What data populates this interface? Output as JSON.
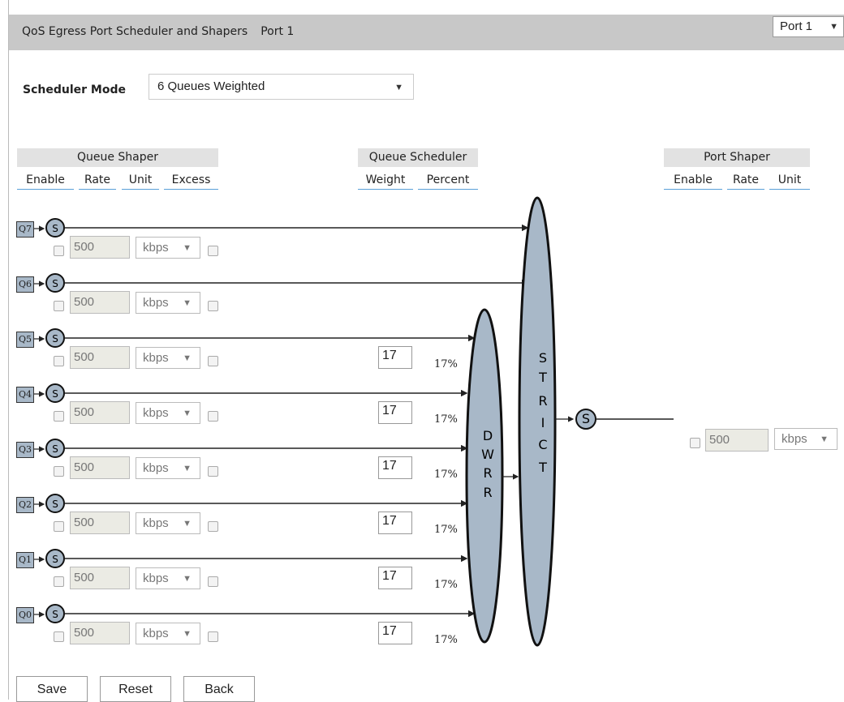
{
  "header": {
    "title": "QoS Egress Port Scheduler and Shapers",
    "port_label": "Port 1",
    "port_select": "Port 1"
  },
  "scheduler": {
    "label": "Scheduler Mode",
    "mode": "6 Queues Weighted"
  },
  "groups": {
    "queue_shaper": "Queue Shaper",
    "queue_scheduler": "Queue Scheduler",
    "port_shaper": "Port Shaper"
  },
  "columns": {
    "enable": "Enable",
    "rate": "Rate",
    "unit": "Unit",
    "excess": "Excess",
    "weight": "Weight",
    "percent": "Percent",
    "port_enable": "Enable",
    "port_rate": "Rate",
    "port_unit": "Unit"
  },
  "queues": [
    {
      "label": "Q7",
      "rate": "500",
      "unit": "kbps",
      "weight": "",
      "percent": ""
    },
    {
      "label": "Q6",
      "rate": "500",
      "unit": "kbps",
      "weight": "",
      "percent": ""
    },
    {
      "label": "Q5",
      "rate": "500",
      "unit": "kbps",
      "weight": "17",
      "percent": "17%"
    },
    {
      "label": "Q4",
      "rate": "500",
      "unit": "kbps",
      "weight": "17",
      "percent": "17%"
    },
    {
      "label": "Q3",
      "rate": "500",
      "unit": "kbps",
      "weight": "17",
      "percent": "17%"
    },
    {
      "label": "Q2",
      "rate": "500",
      "unit": "kbps",
      "weight": "17",
      "percent": "17%"
    },
    {
      "label": "Q1",
      "rate": "500",
      "unit": "kbps",
      "weight": "17",
      "percent": "17%"
    },
    {
      "label": "Q0",
      "rate": "500",
      "unit": "kbps",
      "weight": "17",
      "percent": "17%"
    }
  ],
  "diagram": {
    "shaper_symbol": "S",
    "dwrr_letters": [
      "D",
      "W",
      "R",
      "R"
    ],
    "strict_letters": [
      "S",
      "T",
      "R",
      "I",
      "C",
      "T"
    ]
  },
  "port_shaper": {
    "rate": "500",
    "unit": "kbps"
  },
  "buttons": {
    "save": "Save",
    "reset": "Reset",
    "back": "Back"
  },
  "colors": {
    "header_bg": "#c8c8c8",
    "shaper_fill": "#a8b8c8",
    "link_underline": "#5aa0d8"
  }
}
